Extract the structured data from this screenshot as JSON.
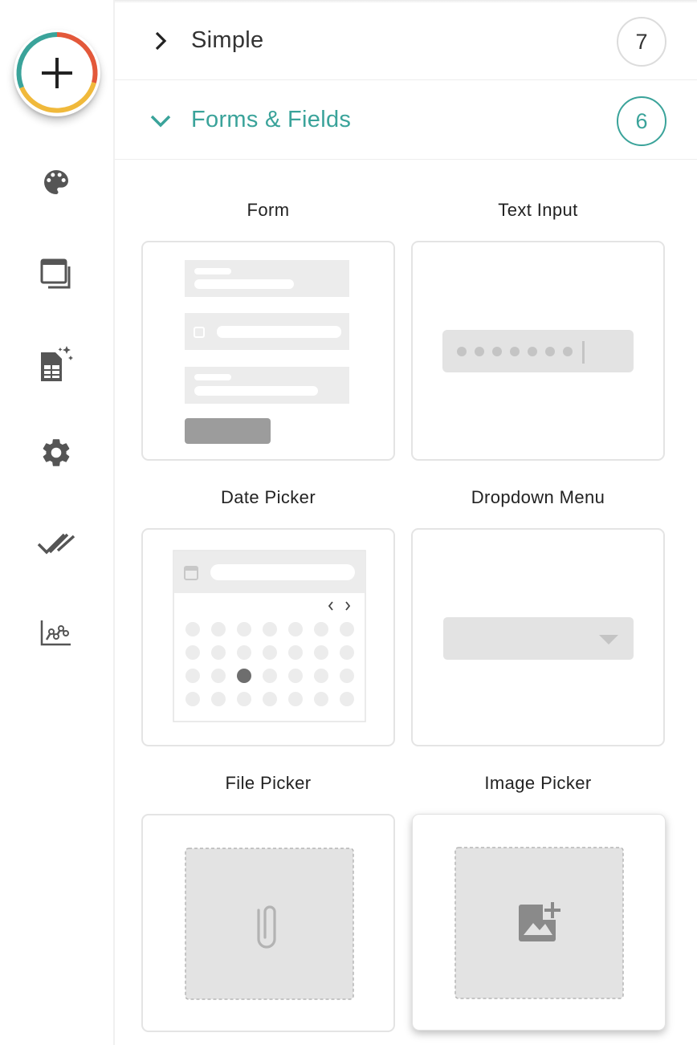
{
  "sidebar": {
    "add_button": "+",
    "icons": [
      "palette-icon",
      "screens-icon",
      "data-sheet-icon",
      "settings-icon",
      "checks-icon",
      "analytics-icon"
    ],
    "add_ring_colors": [
      "#3aa39a",
      "#e3583a",
      "#f0b93b"
    ]
  },
  "sections": [
    {
      "title": "Simple",
      "count": "7",
      "expanded": false
    },
    {
      "title": "Forms & Fields",
      "count": "6",
      "expanded": true
    }
  ],
  "components": [
    {
      "label": "Form"
    },
    {
      "label": "Text Input"
    },
    {
      "label": "Date Picker"
    },
    {
      "label": "Dropdown Menu"
    },
    {
      "label": "File Picker"
    },
    {
      "label": "Image Picker"
    }
  ],
  "colors": {
    "accent": "#3aa39a",
    "placeholder": "#e8e8e8",
    "dark_placeholder": "#9c9c9c"
  }
}
